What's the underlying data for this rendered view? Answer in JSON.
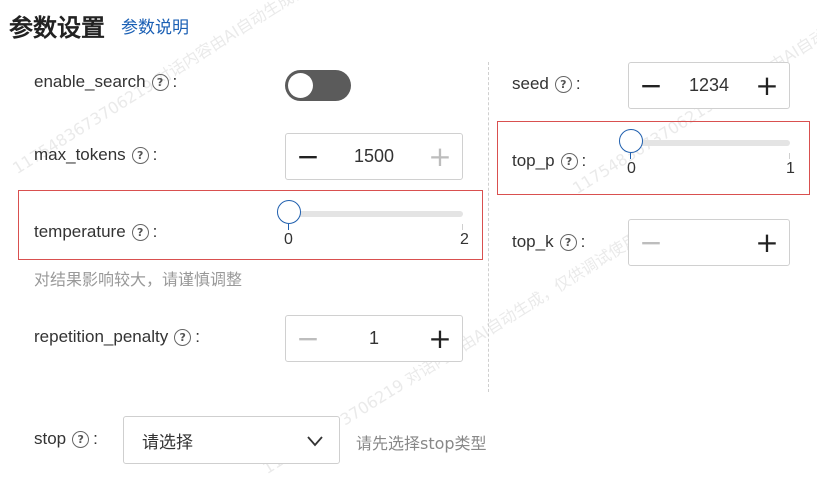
{
  "header": {
    "title": "参数设置",
    "help_link": "参数说明"
  },
  "watermark_text": "1175483673706219 对话内容由AI自动生成，仅供调试使用",
  "params": {
    "enable_search": {
      "label": "enable_search",
      "value": false
    },
    "max_tokens": {
      "label": "max_tokens",
      "value": "1500",
      "minus": "−",
      "plus": "+"
    },
    "temperature": {
      "label": "temperature",
      "min": "0",
      "max": "2",
      "value": 0,
      "hint": "对结果影响较大，请谨慎调整"
    },
    "repetition_penalty": {
      "label": "repetition_penalty",
      "value": "1",
      "minus": "−",
      "plus": "+"
    },
    "stop": {
      "label": "stop",
      "placeholder": "请选择",
      "tip": "请先选择stop类型"
    },
    "seed": {
      "label": "seed",
      "value": "1234",
      "minus": "−",
      "plus": "+"
    },
    "top_p": {
      "label": "top_p",
      "min": "0",
      "max": "1",
      "value": 0
    },
    "top_k": {
      "label": "top_k",
      "value": "",
      "minus": "−",
      "plus": "+"
    }
  },
  "help_icon": "?",
  "colon": ":",
  "colors": {
    "accent": "#1f5fae",
    "highlight_border": "#d9504f",
    "toggle_off": "#5b5b5b"
  }
}
